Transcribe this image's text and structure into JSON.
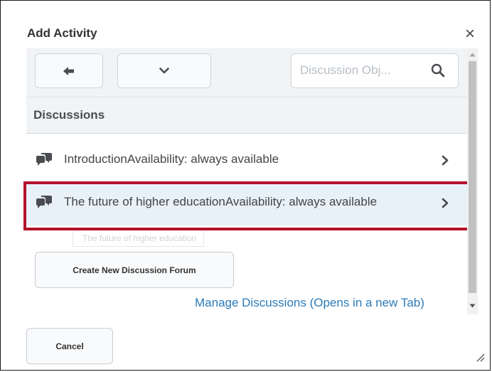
{
  "dialog": {
    "title": "Add Activity",
    "close_glyph": "×"
  },
  "toolbar": {
    "search_placeholder": "Discussion Obj..."
  },
  "section": {
    "label": "Discussions"
  },
  "items": [
    {
      "text": "IntroductionAvailability: always available"
    },
    {
      "text": "The future of higher educationAvailability: always available",
      "highlighted": true
    }
  ],
  "tooltip": {
    "text": "The future of higher education"
  },
  "actions": {
    "create_label": "Create New Discussion Forum",
    "manage_link": "Manage Discussions (Opens in a new Tab)"
  },
  "footer": {
    "cancel_label": "Cancel"
  },
  "colors": {
    "link": "#2b7bb9",
    "highlight_border": "#b5122c",
    "selected_row": "#e8f1f7",
    "toolbar_bg": "#f1f3f5"
  },
  "icons": [
    "arrow-left-icon",
    "chevron-down-icon",
    "search-icon",
    "discussion-icon",
    "chevron-right-icon",
    "resize-grip-icon"
  ]
}
